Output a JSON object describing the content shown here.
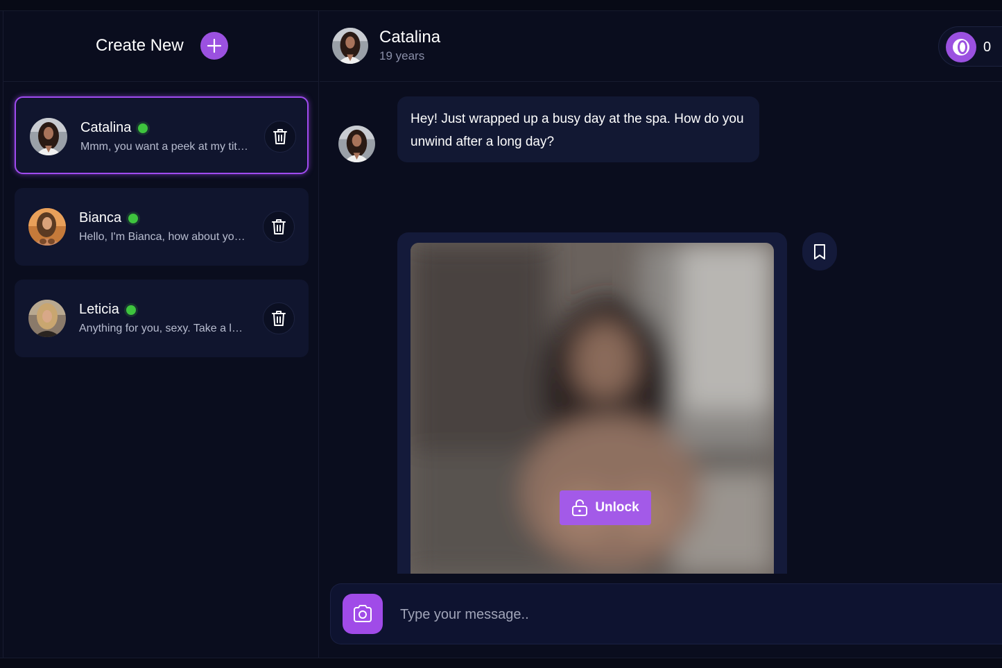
{
  "sidebar": {
    "create_label": "Create New",
    "chats": [
      {
        "name": "Catalina",
        "preview": "Mmm, you want a peek at my tit…",
        "online": true,
        "active": true
      },
      {
        "name": "Bianca",
        "preview": "Hello, I'm Bianca, how about yo…",
        "online": true,
        "active": false
      },
      {
        "name": "Leticia",
        "preview": "Anything for you, sexy. Take a l…",
        "online": true,
        "active": false
      }
    ]
  },
  "header": {
    "name": "Catalina",
    "age": "19 years",
    "coins": "0"
  },
  "messages": {
    "first": "Hey! Just wrapped up a busy day at the spa. How do you unwind after a long day?",
    "unlock_label": "Unlock"
  },
  "composer": {
    "placeholder": "Type your message.."
  },
  "colors": {
    "background": "#0a0d1e",
    "card": "#10152e",
    "accent": "#9b51e0",
    "online": "#3ec43e",
    "muted_text": "#b8bdd0"
  },
  "icons": {
    "create": "plus-icon",
    "delete": "trash-icon",
    "coins": "coin-icon",
    "bookmark": "bookmark-icon",
    "unlock": "unlock-icon",
    "camera": "camera-icon"
  }
}
